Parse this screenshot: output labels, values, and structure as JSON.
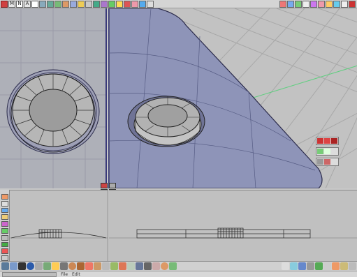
{
  "toolbar_top": {
    "left_buttons": [
      "close",
      "M",
      "N",
      "A",
      "select",
      "lasso",
      "move",
      "rotate",
      "scale",
      "grid",
      "camera",
      "box",
      "sphere",
      "curve",
      "surface",
      "light",
      "render",
      "brush",
      "pen",
      "text"
    ],
    "right_buttons": [
      "win1",
      "win2",
      "win3",
      "win4",
      "win5",
      "win6",
      "win7",
      "win8",
      "win9",
      "win10"
    ],
    "label_m": "M",
    "label_n": "N",
    "label_a": "A"
  },
  "viewports": {
    "left": {
      "name": "left-ortho-view",
      "bg": "#aeb0b8"
    },
    "perspective": {
      "name": "perspective-view",
      "bg": "#c2c2c2"
    },
    "bottom_left": {
      "name": "side-view"
    },
    "bottom_right": {
      "name": "front-view"
    }
  },
  "colors": {
    "grid_line": "#9a9aa8",
    "surface_blue": "#8e94b8",
    "surface_edge": "#2a2a4a",
    "model_gray": "#b6b6b6",
    "active_border": "#3a3a7a",
    "axis_green": "#5fcf7f"
  },
  "statusbar": {
    "field_placeholder": "",
    "menu_file": "File",
    "menu_edit": "Edit"
  }
}
